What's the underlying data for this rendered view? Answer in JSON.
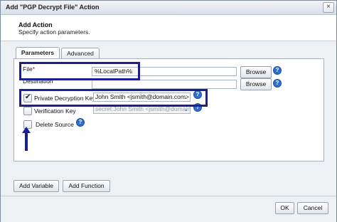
{
  "dialog": {
    "title": "Add \"PGP Decrypt File\" Action",
    "close_glyph": "×",
    "header_title": "Add Action",
    "header_subtitle": "Specify action parameters."
  },
  "tabs": [
    {
      "label": "Parameters",
      "active": true
    },
    {
      "label": "Advanced",
      "active": false
    }
  ],
  "fields": {
    "file_label": "File",
    "required_mark": "*",
    "file_value": "%LocalPath%",
    "destination_label": "Destination",
    "destination_value": "",
    "browse_label": "Browse",
    "private_key_label": "Private Decryption Key",
    "private_key_value": "John Smith <jsmith@domain.com>",
    "private_key_checked": true,
    "verification_key_label": "Verification Key",
    "verification_key_value": "secret:John Smith <jsmith@domain.com>",
    "verification_key_checked": false,
    "delete_source_label": "Delete Source",
    "delete_source_checked": false,
    "help_glyph": "?",
    "dropdown_glyph": "⌄"
  },
  "buttons": {
    "add_variable": "Add Variable",
    "add_function": "Add Function",
    "ok": "OK",
    "cancel": "Cancel"
  },
  "colors": {
    "highlight": "#1b1f8f",
    "help_icon": "#2c6fd1",
    "required": "#d00000"
  }
}
